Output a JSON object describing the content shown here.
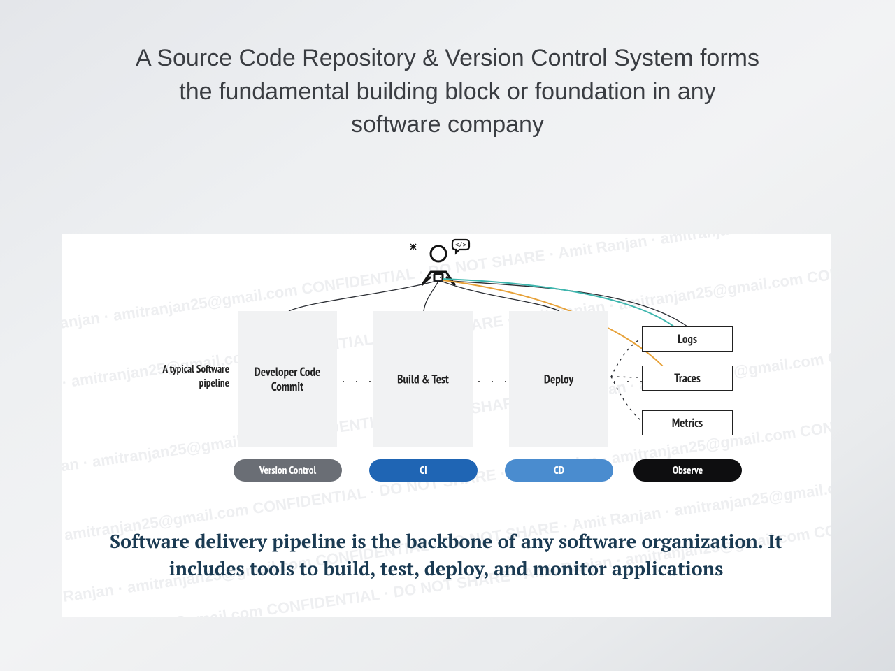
{
  "headline": "A Source Code Repository & Version Control System forms the fundamental building block or foundation in any software company",
  "watermark_full": "Amit Ranjan · amitranjan25@gmail.com CONFIDENTIAL · DO NOT SHARE · Amit Ranjan · amitranjan25@gmail.com CONFIDENTIAL · DO NOT SHARE",
  "pipeline_caption": "A typical Software pipeline",
  "stages": {
    "dev": "Developer Code Commit",
    "build": "Build & Test",
    "deploy": "Deploy"
  },
  "stage_sep": "·  ·  ·",
  "observe_boxes": {
    "logs": "Logs",
    "traces": "Traces",
    "metrics": "Metrics"
  },
  "pills": {
    "vc": "Version Control",
    "ci": "CI",
    "cd": "CD",
    "observe": "Observe"
  },
  "bottom_caption": "Software delivery pipeline is the backbone of any software organization. It includes tools to build, test, deploy, and monitor applications",
  "colors": {
    "vc": "#6a6e75",
    "ci": "#1f65b4",
    "cd": "#4a8ccf",
    "observe": "#0e0e10",
    "curve_teal": "#3eb6ae",
    "curve_orange": "#e7a23a"
  }
}
